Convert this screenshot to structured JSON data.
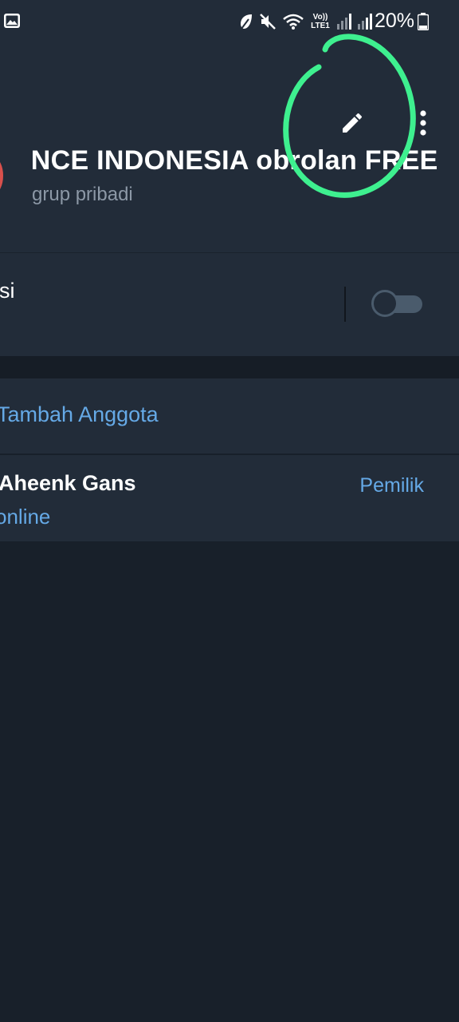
{
  "status_bar": {
    "battery_percent": "20%",
    "icons": [
      "gallery-icon",
      "leaf-icon",
      "mute-icon",
      "wifi-icon",
      "volte-lte-icon",
      "signal-icon",
      "signal-icon",
      "battery-icon"
    ],
    "volte_text": "Vo)) LTE1"
  },
  "header": {
    "title": "INCE INDONESIA obrolan    FREE",
    "subtitle": "grup pribadi",
    "edit_icon": "pencil-icon",
    "menu_icon": "more-vertical-icon",
    "annotation_color": "#3ef08f"
  },
  "notifications": {
    "label": "asi",
    "toggle_on": false
  },
  "members": {
    "add_label": "Tambah Anggota",
    "list": [
      {
        "name": "Aheenk Gans",
        "status": "online",
        "role": "Pemilik"
      }
    ]
  },
  "colors": {
    "background": "#18202a",
    "surface": "#222c39",
    "accent": "#65a9e6",
    "muted_text": "#8c98a6"
  }
}
